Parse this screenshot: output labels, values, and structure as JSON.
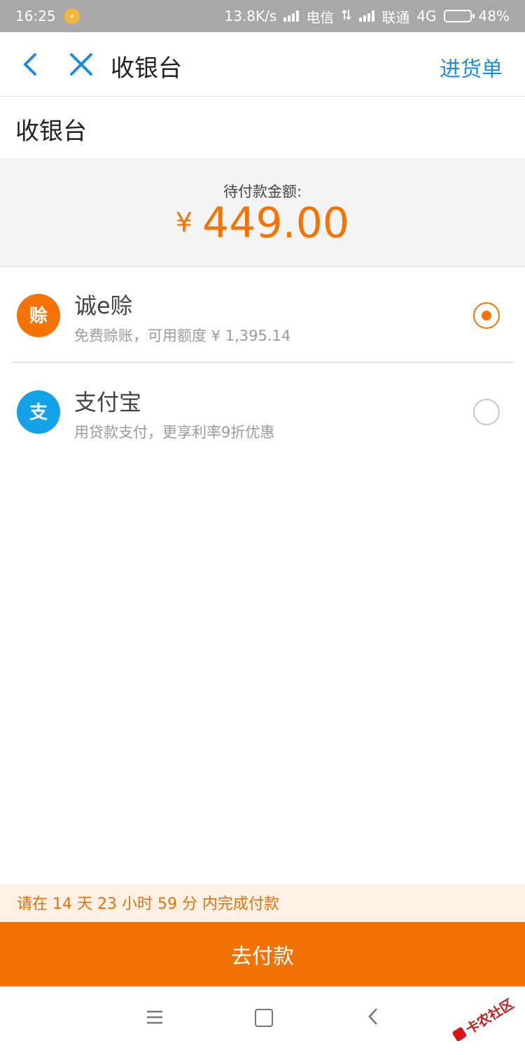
{
  "status_bar": {
    "time": "16:25",
    "speed": "13.8K/s",
    "carrier1": "电信",
    "carrier2": "联通",
    "network": "4G",
    "battery": "48%",
    "battery_level": 0.48
  },
  "nav": {
    "back_icon": "chevron-left-icon",
    "close_icon": "close-icon",
    "title": "收银台",
    "action": "进货单"
  },
  "section_title": "收银台",
  "amount": {
    "label": "待付款金额:",
    "currency": "¥",
    "value": "449.00"
  },
  "payment_options": [
    {
      "icon_glyph": "赊",
      "icon_color": "#f37405",
      "name": "诚e赊",
      "description": "免费赊账，可用额度 ¥ 1,395.14",
      "selected": true
    },
    {
      "icon_glyph": "支",
      "icon_color": "#13a1e8",
      "name": "支付宝",
      "description": "用贷款支付，更享利率9折优惠",
      "selected": false
    }
  ],
  "notice": "请在 14 天 23 小时 59 分 内完成付款",
  "pay_button": "去付款",
  "watermark": "卡农社区",
  "colors": {
    "accent": "#f37405",
    "link": "#1e8ce0",
    "alipay": "#13a1e8"
  }
}
